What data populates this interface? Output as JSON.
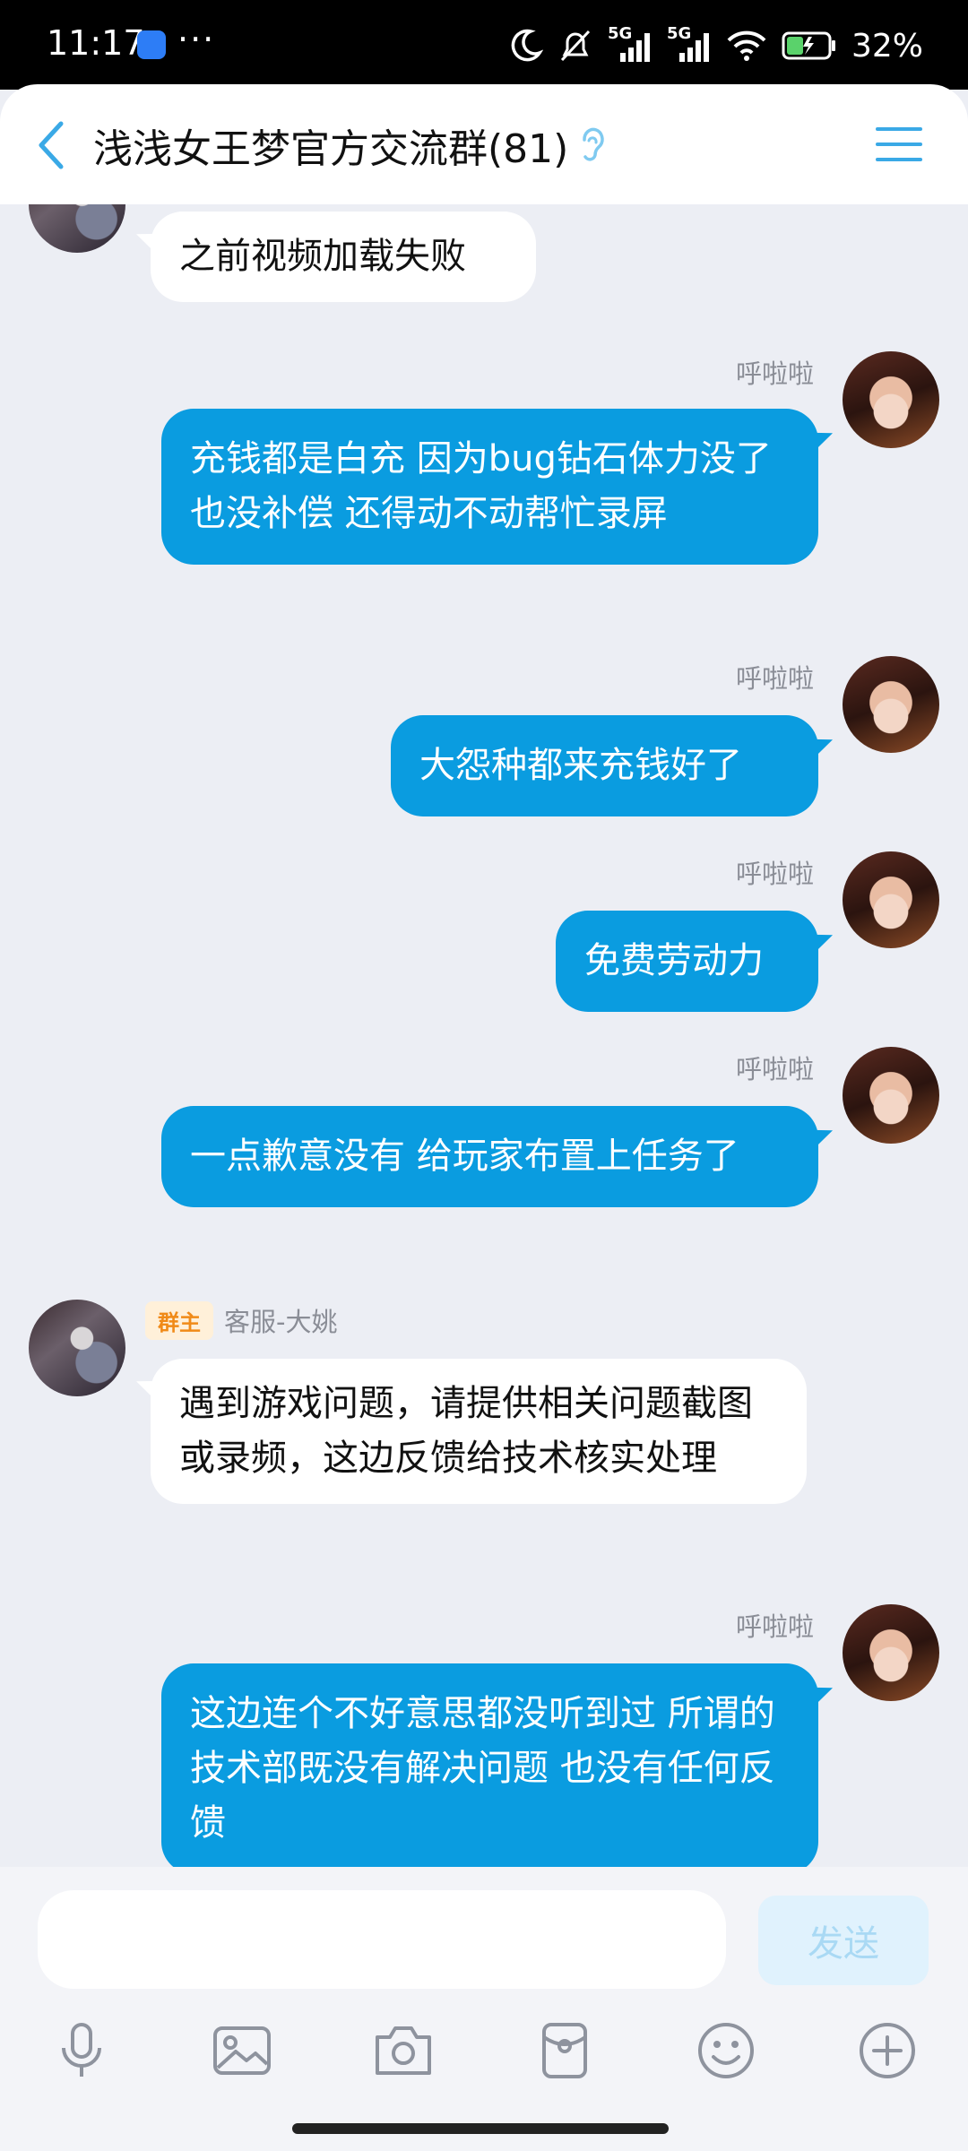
{
  "status_bar": {
    "time": "11:17",
    "more": "···",
    "network_1": "5G",
    "network_2": "5G",
    "battery": "32%"
  },
  "header": {
    "title": "浅浅女王梦官方交流群(81)",
    "icons": [
      "back-arrow-icon",
      "ear-icon",
      "menu-icon"
    ],
    "accent_color": "#3aa9e6"
  },
  "messages": [
    {
      "side": "left",
      "text": "之前视频加载失败"
    },
    {
      "side": "right",
      "sender": "呼啦啦",
      "text": "充钱都是白充 因为bug钻石体力没了 也没补偿 还得动不动帮忙录屏"
    },
    {
      "side": "right",
      "sender": "呼啦啦",
      "text": "大怨种都来充钱好了"
    },
    {
      "side": "right",
      "sender": "呼啦啦",
      "text": "免费劳动力"
    },
    {
      "side": "right",
      "sender": "呼啦啦",
      "text": "一点歉意没有 给玩家布置上任务了"
    },
    {
      "side": "left",
      "badge": "群主",
      "sender": "客服-大姚",
      "text": "遇到游戏问题，请提供相关问题截图或录频，这边反馈给技术核实处理"
    },
    {
      "side": "right",
      "sender": "呼啦啦",
      "text": "这边连个不好意思都没听到过 所谓的技术部既没有解决问题 也没有任何反馈"
    }
  ],
  "composer": {
    "input_value": "",
    "send_label": "发送",
    "tools": [
      "microphone-icon",
      "image-icon",
      "camera-icon",
      "red-packet-icon",
      "emoji-icon",
      "plus-icon"
    ]
  },
  "colors": {
    "my_bubble": "#0a9ce0",
    "other_bubble": "#ffffff",
    "background": "#eceef4"
  }
}
